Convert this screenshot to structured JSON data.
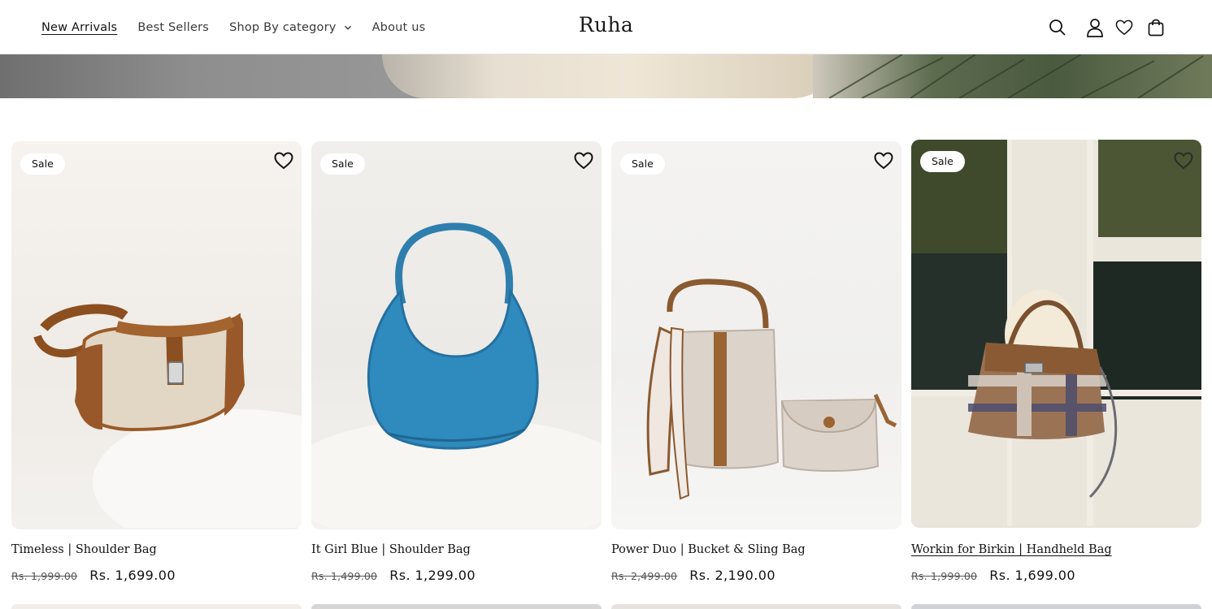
{
  "header": {
    "brand": "Ruha",
    "nav": [
      {
        "label": "New Arrivals",
        "active": true
      },
      {
        "label": "Best Sellers",
        "active": false
      },
      {
        "label": "Shop By category",
        "active": false,
        "dropdown": true
      },
      {
        "label": "About us",
        "active": false
      }
    ],
    "icons": [
      "search-icon",
      "account-icon",
      "wishlist-icon",
      "cart-icon"
    ]
  },
  "products": [
    {
      "badge": "Sale",
      "title": "Timeless | Shoulder Bag",
      "old_price": "Rs. 1,999.00",
      "price": "Rs. 1,699.00",
      "image": "beige-brown-shoulder-bag"
    },
    {
      "badge": "Sale",
      "title": "It Girl Blue | Shoulder Bag",
      "old_price": "Rs. 1,499.00",
      "price": "Rs. 1,299.00",
      "image": "blue-crescent-bag"
    },
    {
      "badge": "Sale",
      "title": "Power Duo | Bucket & Sling Bag",
      "old_price": "Rs. 2,499.00",
      "price": "Rs. 2,190.00",
      "image": "bucket-and-sling-bag"
    },
    {
      "badge": "Sale",
      "title": "Workin for Birkin | Handheld Bag",
      "old_price": "Rs. 1,999.00",
      "price": "Rs. 1,699.00",
      "image": "plaid-handheld-bag"
    }
  ],
  "colors": {
    "text": "#121212",
    "muted": "#555555",
    "border": "#e6e6e6"
  }
}
